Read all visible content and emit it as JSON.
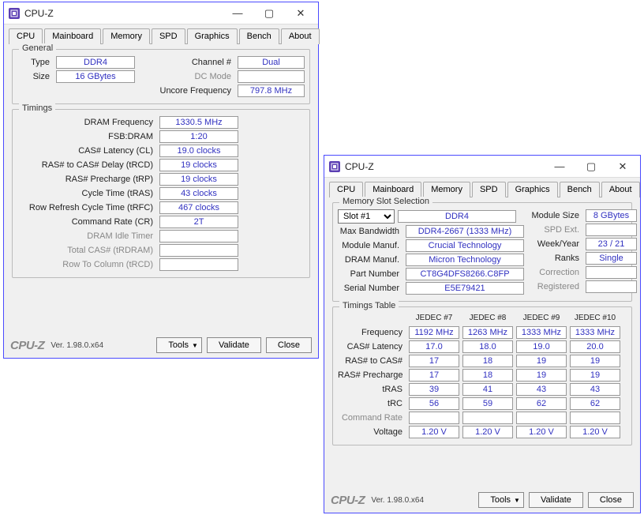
{
  "app_title": "CPU-Z",
  "brand": "CPU-Z",
  "version": "Ver. 1.98.0.x64",
  "tabs": [
    "CPU",
    "Mainboard",
    "Memory",
    "SPD",
    "Graphics",
    "Bench",
    "About"
  ],
  "buttons": {
    "tools": "Tools",
    "validate": "Validate",
    "close": "Close"
  },
  "win1": {
    "active_tab": "Memory",
    "general": {
      "legend": "General",
      "type_label": "Type",
      "type": "DDR4",
      "size_label": "Size",
      "size": "16 GBytes",
      "channel_label": "Channel #",
      "channel": "Dual",
      "dcmode_label": "DC Mode",
      "dcmode": "",
      "uncore_label": "Uncore Frequency",
      "uncore": "797.8 MHz"
    },
    "timings": {
      "legend": "Timings",
      "rows": [
        {
          "label": "DRAM Frequency",
          "value": "1330.5 MHz"
        },
        {
          "label": "FSB:DRAM",
          "value": "1:20"
        },
        {
          "label": "CAS# Latency (CL)",
          "value": "19.0 clocks"
        },
        {
          "label": "RAS# to CAS# Delay (tRCD)",
          "value": "19 clocks"
        },
        {
          "label": "RAS# Precharge (tRP)",
          "value": "19 clocks"
        },
        {
          "label": "Cycle Time (tRAS)",
          "value": "43 clocks"
        },
        {
          "label": "Row Refresh Cycle Time (tRFC)",
          "value": "467 clocks"
        },
        {
          "label": "Command Rate (CR)",
          "value": "2T"
        },
        {
          "label": "DRAM Idle Timer",
          "value": "",
          "dim": true
        },
        {
          "label": "Total CAS# (tRDRAM)",
          "value": "",
          "dim": true
        },
        {
          "label": "Row To Column (tRCD)",
          "value": "",
          "dim": true
        }
      ]
    }
  },
  "win2": {
    "active_tab": "SPD",
    "slotsel": {
      "legend": "Memory Slot Selection",
      "slot": "Slot #1",
      "type": "DDR4",
      "maxbw_label": "Max Bandwidth",
      "maxbw": "DDR4-2667 (1333 MHz)",
      "modmanuf_label": "Module Manuf.",
      "modmanuf": "Crucial Technology",
      "drammanuf_label": "DRAM Manuf.",
      "drammanuf": "Micron Technology",
      "partnum_label": "Part Number",
      "partnum": "CT8G4DFS8266.C8FP",
      "serial_label": "Serial Number",
      "serial": "E5E79421",
      "modsize_label": "Module Size",
      "modsize": "8 GBytes",
      "spdext_label": "SPD Ext.",
      "spdext": "",
      "weekyear_label": "Week/Year",
      "weekyear": "23 / 21",
      "ranks_label": "Ranks",
      "ranks": "Single",
      "correction_label": "Correction",
      "correction": "",
      "registered_label": "Registered",
      "registered": ""
    },
    "ttable": {
      "legend": "Timings Table",
      "headers": [
        "JEDEC #7",
        "JEDEC #8",
        "JEDEC #9",
        "JEDEC #10"
      ],
      "rows": [
        {
          "label": "Frequency",
          "v": [
            "1192 MHz",
            "1263 MHz",
            "1333 MHz",
            "1333 MHz"
          ]
        },
        {
          "label": "CAS# Latency",
          "v": [
            "17.0",
            "18.0",
            "19.0",
            "20.0"
          ]
        },
        {
          "label": "RAS# to CAS#",
          "v": [
            "17",
            "18",
            "19",
            "19"
          ]
        },
        {
          "label": "RAS# Precharge",
          "v": [
            "17",
            "18",
            "19",
            "19"
          ]
        },
        {
          "label": "tRAS",
          "v": [
            "39",
            "41",
            "43",
            "43"
          ]
        },
        {
          "label": "tRC",
          "v": [
            "56",
            "59",
            "62",
            "62"
          ]
        },
        {
          "label": "Command Rate",
          "v": [
            "",
            "",
            "",
            ""
          ],
          "dim": true
        },
        {
          "label": "Voltage",
          "v": [
            "1.20 V",
            "1.20 V",
            "1.20 V",
            "1.20 V"
          ]
        }
      ]
    }
  }
}
